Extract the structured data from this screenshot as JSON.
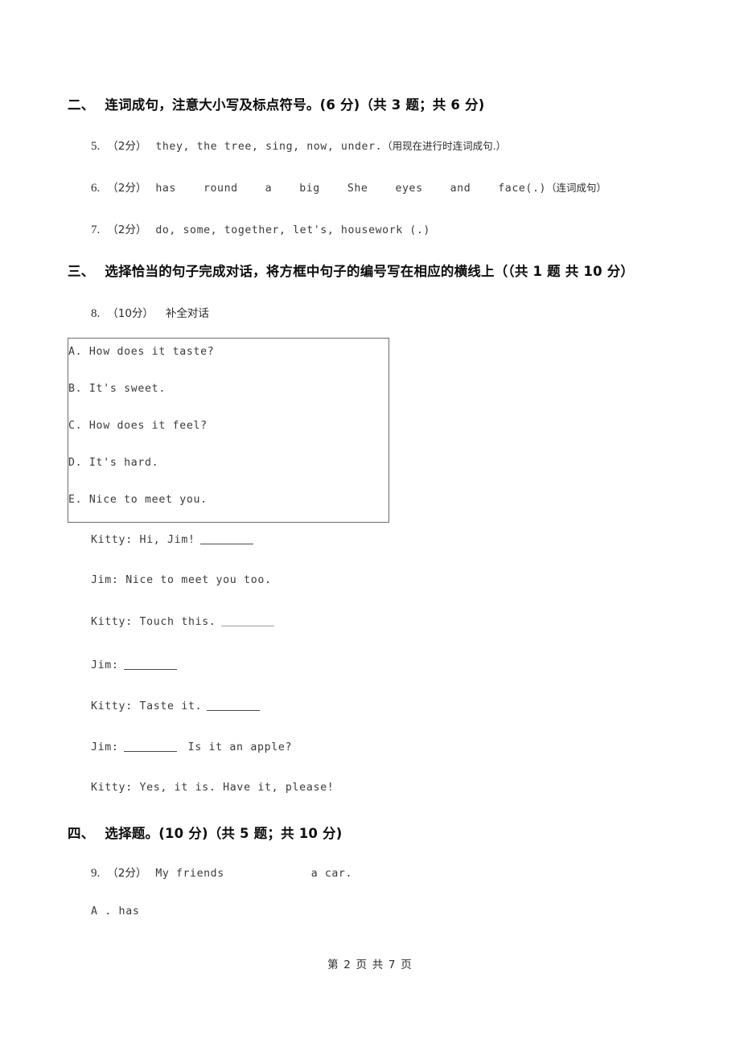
{
  "page": {
    "footer": "第 2 页 共 7 页",
    "background_color": "#ffffff",
    "text_color": "#2b2b2b",
    "border_color": "#6d6d6d"
  },
  "sections": [
    {
      "number": "二、",
      "heading": "连词成句，注意大小写及标点符号。(6 分)（共 3 题；共 6 分)"
    },
    {
      "number": "三、",
      "heading": "选择恰当的句子完成对话，将方框中句子的编号写在相应的横线上（（共 1 题 共 10 分）"
    },
    {
      "number": "四、",
      "heading": "选择题。(10 分)（共 5 题；共 10 分)"
    }
  ],
  "questions": [
    {
      "num": "5.",
      "score": "（2分）",
      "text": "they, the tree, sing, now, under.",
      "note": "（用现在进行时连词成句.）"
    },
    {
      "num": "6.",
      "score": "（2分）",
      "words": [
        "has",
        "round",
        "a",
        "big",
        "She",
        "eyes",
        "and",
        "face(.)"
      ],
      "note": "（连词成句）"
    },
    {
      "num": "7.",
      "score": "（2分）",
      "text": "do, some, together, let's, housework (.)"
    },
    {
      "num": "8.",
      "score": "（10分）",
      "text": "补全对话"
    },
    {
      "num": "9.",
      "score": "（2分）",
      "before_blank": "My friends",
      "after_blank": "a car."
    }
  ],
  "choice_box": {
    "options": [
      "A. How does it taste?",
      "B. It's sweet.",
      "C. How does it feel?",
      "D. It's hard.",
      "E. Nice to meet you."
    ]
  },
  "dialogue": [
    {
      "speaker_text": "Kitty: Hi, Jim!",
      "blank_after": true,
      "trailing": ""
    },
    {
      "speaker_text": "Jim: Nice to meet you too.",
      "blank_after": false,
      "trailing": ""
    },
    {
      "speaker_text": "Kitty: Touch this.",
      "blank_after": true,
      "blank_faint": true,
      "trailing": ""
    },
    {
      "speaker_text": "Jim:",
      "blank_after": true,
      "trailing": ""
    },
    {
      "speaker_text": "Kitty: Taste it.",
      "blank_after": true,
      "trailing": ""
    },
    {
      "speaker_text": "Jim:",
      "blank_after": true,
      "trailing": "Is it an apple?"
    },
    {
      "speaker_text": "Kitty: Yes, it is. Have it, please!",
      "blank_after": false,
      "trailing": ""
    }
  ],
  "answer_options": [
    {
      "label": "A . has"
    }
  ]
}
